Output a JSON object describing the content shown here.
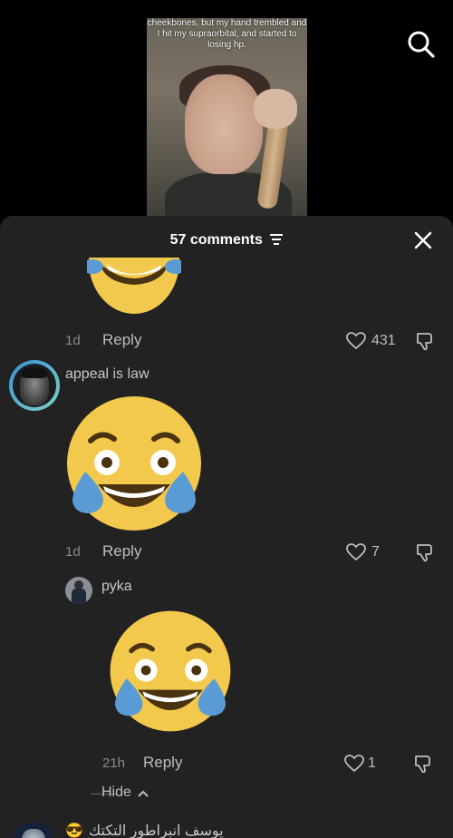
{
  "video": {
    "caption": "cheekbones, but my hand trembled and I hit my supraorbital, and started to losing hp."
  },
  "header": {
    "comment_count": "57 comments"
  },
  "comments": [
    {
      "time": "1d",
      "reply_label": "Reply",
      "likes": "431",
      "emoji": "rolling-on-floor-laughing"
    },
    {
      "username": "appeal is law",
      "time": "1d",
      "reply_label": "Reply",
      "likes": "7",
      "emoji": "face-with-tears-of-joy"
    },
    {
      "username": "руkа",
      "time": "21h",
      "reply_label": "Reply",
      "likes": "1",
      "emoji": "face-with-tears-of-joy",
      "is_reply": true
    }
  ],
  "hide_label": "Hide",
  "next_comment": {
    "username": "يوسف انبراطور التكتك",
    "emoji": "😎"
  },
  "colors": {
    "sheet_bg": "#222222",
    "emoji_yellow": "#f2c94c",
    "tear_blue": "#5b9bd5"
  }
}
